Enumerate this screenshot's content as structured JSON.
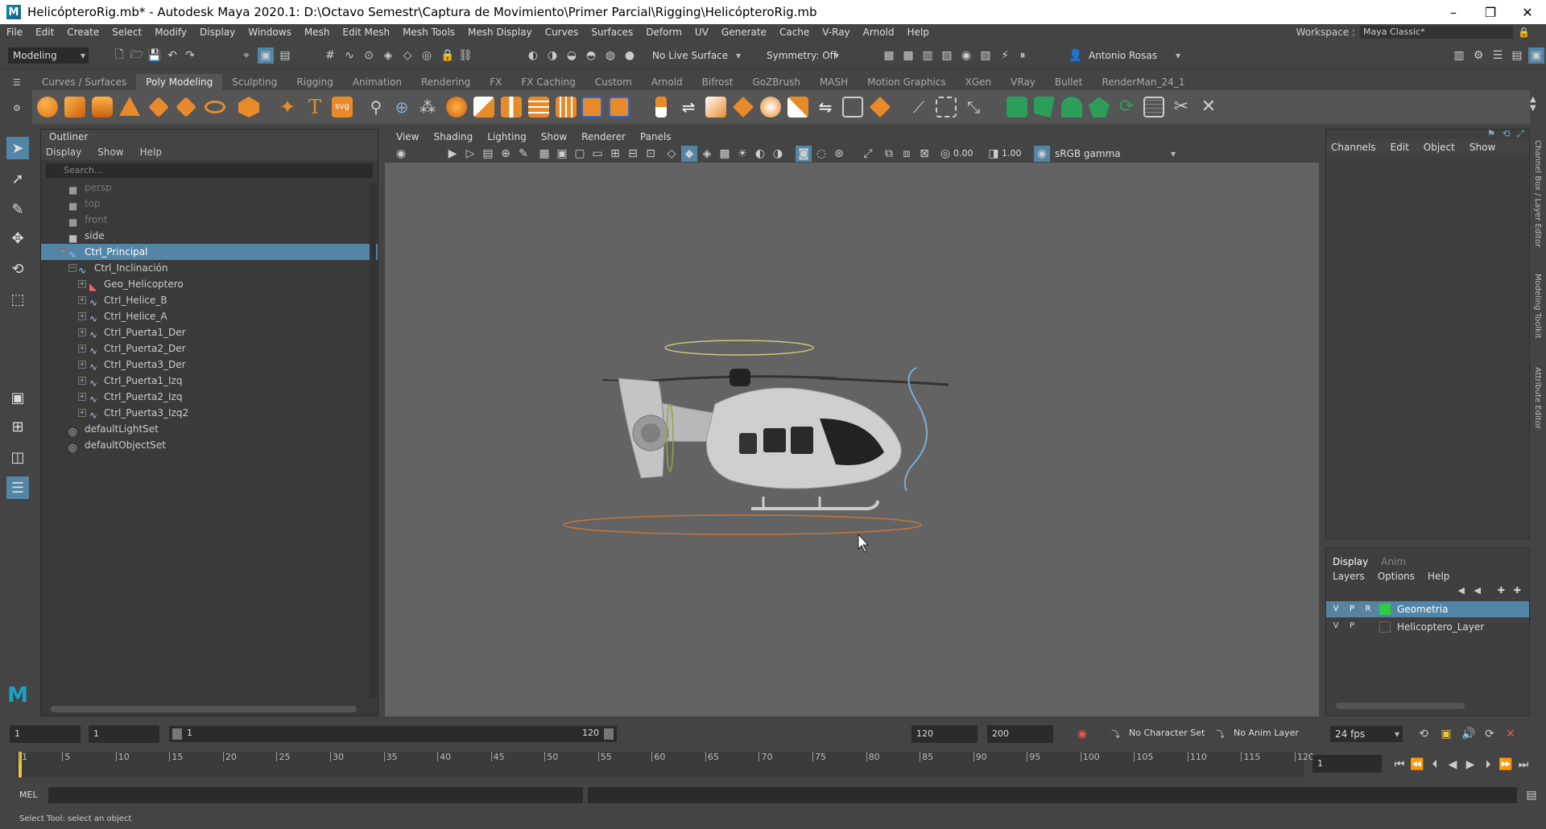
{
  "window": {
    "title": "HelicópteroRig.mb* - Autodesk Maya 2020.1: D:\\Octavo Semestr\\Captura de Movimiento\\Primer Parcial\\Rigging\\HelicópteroRig.mb",
    "app_icon": "maya-icon",
    "minimize": "–",
    "restore": "❐",
    "close": "✕"
  },
  "menubar": {
    "items": [
      "File",
      "Edit",
      "Create",
      "Select",
      "Modify",
      "Display",
      "Windows",
      "Mesh",
      "Edit Mesh",
      "Mesh Tools",
      "Mesh Display",
      "Curves",
      "Surfaces",
      "Deform",
      "UV",
      "Generate",
      "Cache",
      "V-Ray",
      "Arnold",
      "Help"
    ],
    "workspace_label": "Workspace :",
    "workspace_value": "Maya Classic*"
  },
  "statusline": {
    "menuset": "Modeling",
    "live_surface": "No Live Surface",
    "symmetry": "Symmetry: Off",
    "user": "Antonio Rosas"
  },
  "shelf": {
    "tabs": [
      "Curves / Surfaces",
      "Poly Modeling",
      "Sculpting",
      "Rigging",
      "Animation",
      "Rendering",
      "FX",
      "FX Caching",
      "Custom",
      "Arnold",
      "Bifrost",
      "GoZBrush",
      "MASH",
      "Motion Graphics",
      "XGen",
      "VRay",
      "Bullet",
      "RenderMan_24_1"
    ],
    "active_tab": "Poly Modeling",
    "svg_label": "svg",
    "text_label": "T"
  },
  "outliner": {
    "title": "Outliner",
    "menu": [
      "Display",
      "Show",
      "Help"
    ],
    "search_placeholder": "Search...",
    "items": [
      {
        "label": "persp",
        "dim": true
      },
      {
        "label": "top",
        "dim": true
      },
      {
        "label": "front",
        "dim": true
      },
      {
        "label": "side",
        "dim": false
      },
      {
        "label": "Ctrl_Principal",
        "selected": true
      },
      {
        "label": "Ctrl_Inclinación"
      },
      {
        "label": "Geo_Helicoptero"
      },
      {
        "label": "Ctrl_Helice_B"
      },
      {
        "label": "Ctrl_Helice_A"
      },
      {
        "label": "Ctrl_Puerta1_Der"
      },
      {
        "label": "Ctrl_Puerta2_Der"
      },
      {
        "label": "Ctrl_Puerta3_Der"
      },
      {
        "label": "Ctrl_Puerta1_Izq"
      },
      {
        "label": "Ctrl_Puerta2_Izq"
      },
      {
        "label": "Ctrl_Puerta3_Izq2"
      },
      {
        "label": "defaultLightSet"
      },
      {
        "label": "defaultObjectSet"
      }
    ]
  },
  "viewport": {
    "menu": [
      "View",
      "Shading",
      "Lighting",
      "Show",
      "Renderer",
      "Panels"
    ],
    "exposure": "0.00",
    "gamma": "1.00",
    "color_space": "sRGB gamma"
  },
  "channelbox": {
    "menu": [
      "Channels",
      "Edit",
      "Object",
      "Show"
    ]
  },
  "layereditor": {
    "tabs": [
      "Display",
      "Anim"
    ],
    "active_tab": "Display",
    "menu": [
      "Layers",
      "Options",
      "Help"
    ],
    "layers": [
      {
        "v": "V",
        "p": "P",
        "r": "R",
        "name": "Geometria",
        "color": "#2ecc40",
        "selected": true
      },
      {
        "v": "V",
        "p": "P",
        "r": "",
        "name": "Helicoptero_Layer",
        "color": "",
        "selected": false
      }
    ]
  },
  "sidetabs": [
    "Channel Box / Layer Editor",
    "Modeling Toolkit",
    "Attribute Editor"
  ],
  "range": {
    "start": "1",
    "playback_start": "1",
    "slider_start": "1",
    "slider_end": "120",
    "playback_end": "120",
    "end": "200",
    "character_set": "No Character Set",
    "anim_layer": "No Anim Layer",
    "fps": "24 fps"
  },
  "timeslider": {
    "ticks": [
      "1",
      "5",
      "10",
      "15",
      "20",
      "25",
      "30",
      "35",
      "40",
      "45",
      "50",
      "55",
      "60",
      "65",
      "70",
      "75",
      "80",
      "85",
      "90",
      "95",
      "100",
      "105",
      "110",
      "115",
      "120"
    ],
    "current_frame": "1"
  },
  "cmdline": {
    "label": "MEL"
  },
  "helpline": {
    "text": "Select Tool: select an object"
  }
}
